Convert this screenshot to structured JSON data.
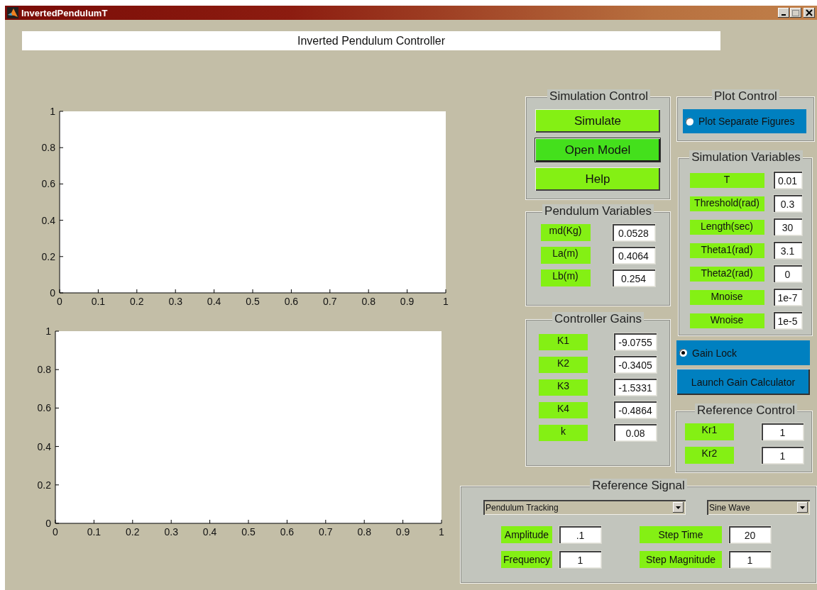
{
  "window": {
    "title": "InvertedPendulumT"
  },
  "header": "Inverted Pendulum Controller",
  "plots": [
    {
      "chart_data": {
        "type": "line",
        "xlim": [
          0,
          1
        ],
        "ylim": [
          0,
          1
        ],
        "xticks": [
          0,
          0.1,
          0.2,
          0.3,
          0.4,
          0.5,
          0.6,
          0.7,
          0.8,
          0.9,
          1
        ],
        "yticks": [
          0,
          0.2,
          0.4,
          0.6,
          0.8,
          1
        ]
      }
    },
    {
      "chart_data": {
        "type": "line",
        "xlim": [
          0,
          1
        ],
        "ylim": [
          0,
          1
        ],
        "xticks": [
          0,
          0.1,
          0.2,
          0.3,
          0.4,
          0.5,
          0.6,
          0.7,
          0.8,
          0.9,
          1
        ],
        "yticks": [
          0,
          0.2,
          0.4,
          0.6,
          0.8,
          1
        ]
      }
    }
  ],
  "simulation_control": {
    "title": "Simulation Control",
    "buttons": [
      {
        "label": "Simulate",
        "kind": "normal"
      },
      {
        "label": "Open Model",
        "kind": "focused"
      },
      {
        "label": "Help",
        "kind": "normal"
      }
    ]
  },
  "pendulum_variables": {
    "title": "Pendulum Variables",
    "fields": [
      {
        "label": "md(Kg)",
        "value": "0.0528"
      },
      {
        "label": "La(m)",
        "value": "0.4064"
      },
      {
        "label": "Lb(m)",
        "value": "0.254"
      }
    ]
  },
  "controller_gains": {
    "title": "Controller Gains",
    "fields": [
      {
        "label": "K1",
        "value": "-9.0755"
      },
      {
        "label": "K2",
        "value": "-0.3405"
      },
      {
        "label": "K3",
        "value": "-1.5331"
      },
      {
        "label": "K4",
        "value": "-0.4864"
      },
      {
        "label": "k",
        "value": "0.08"
      }
    ]
  },
  "plot_control": {
    "title": "Plot Control",
    "option": {
      "label": "Plot Separate Figures",
      "selected": false
    }
  },
  "simulation_variables": {
    "title": "Simulation Variables",
    "fields": [
      {
        "label": "T",
        "value": "0.01"
      },
      {
        "label": "Threshold(rad)",
        "value": "0.3"
      },
      {
        "label": "Length(sec)",
        "value": "30"
      },
      {
        "label": "Theta1(rad)",
        "value": "3.1"
      },
      {
        "label": "Theta2(rad)",
        "value": "0"
      },
      {
        "label": "Mnoise",
        "value": "1e-7"
      },
      {
        "label": "Wnoise",
        "value": "1e-5"
      }
    ]
  },
  "gain_lock": {
    "label": "Gain Lock",
    "selected": true
  },
  "launch_button": "Launch Gain Calculator",
  "reference_control": {
    "title": "Reference Control",
    "fields": [
      {
        "label": "Kr1",
        "value": "1"
      },
      {
        "label": "Kr2",
        "value": "1"
      }
    ]
  },
  "reference_signal": {
    "title": "Reference Signal",
    "dropdowns": [
      {
        "value": "Pendulum Tracking"
      },
      {
        "value": "Sine Wave"
      }
    ],
    "fields": [
      {
        "label": "Amplitude",
        "value": ".1"
      },
      {
        "label": "Step Time",
        "value": "20"
      },
      {
        "label": "Frequency",
        "value": "1"
      },
      {
        "label": "Step Magnitude",
        "value": "1"
      }
    ]
  }
}
